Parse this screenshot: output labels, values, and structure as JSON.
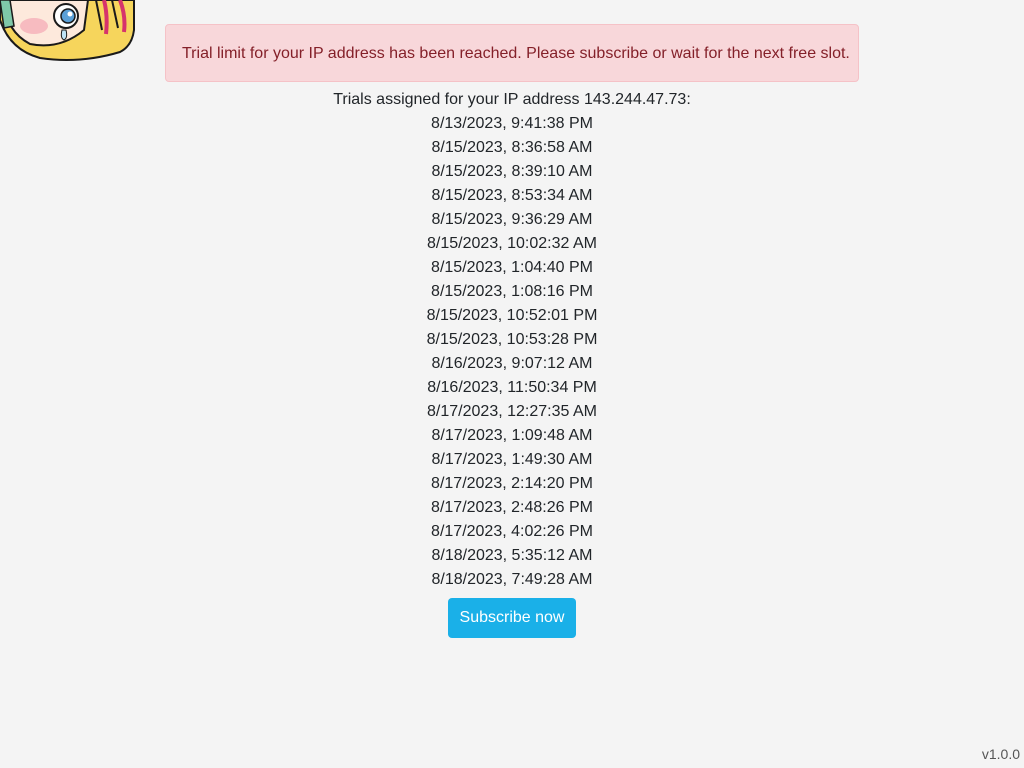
{
  "alert": {
    "message": "Trial limit for your IP address has been reached. Please subscribe or wait for the next free slot."
  },
  "trials": {
    "heading": "Trials assigned for your IP address 143.244.47.73:",
    "entries": [
      "8/13/2023, 9:41:38 PM",
      "8/15/2023, 8:36:58 AM",
      "8/15/2023, 8:39:10 AM",
      "8/15/2023, 8:53:34 AM",
      "8/15/2023, 9:36:29 AM",
      "8/15/2023, 10:02:32 AM",
      "8/15/2023, 1:04:40 PM",
      "8/15/2023, 1:08:16 PM",
      "8/15/2023, 10:52:01 PM",
      "8/15/2023, 10:53:28 PM",
      "8/16/2023, 9:07:12 AM",
      "8/16/2023, 11:50:34 PM",
      "8/17/2023, 12:27:35 AM",
      "8/17/2023, 1:09:48 AM",
      "8/17/2023, 1:49:30 AM",
      "8/17/2023, 2:14:20 PM",
      "8/17/2023, 2:48:26 PM",
      "8/17/2023, 4:02:26 PM",
      "8/18/2023, 5:35:12 AM",
      "8/18/2023, 7:49:28 AM"
    ]
  },
  "subscribe": {
    "label": "Subscribe now"
  },
  "footer": {
    "version": "v1.0.0"
  },
  "logo": {
    "icon": "anime-character-logo"
  },
  "colors": {
    "background": "#f4f4f4",
    "alert_bg": "#f8d7da",
    "alert_border": "#f5c2c7",
    "alert_text": "#842029",
    "button_bg": "#1ab0e8",
    "button_text": "#ffffff"
  }
}
